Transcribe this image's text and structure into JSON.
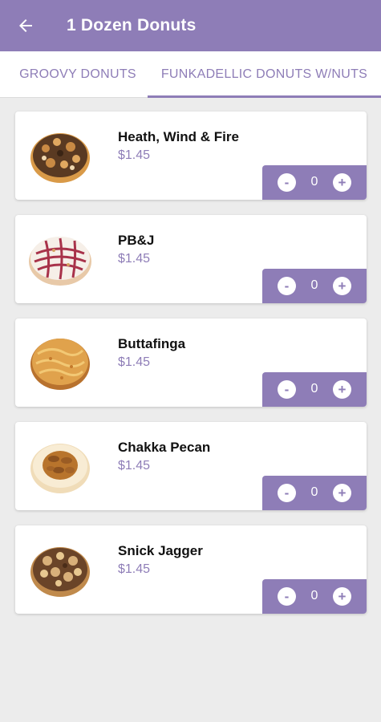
{
  "appbar": {
    "title": "1 Dozen Donuts",
    "back_icon": "arrow-left-icon"
  },
  "tabs": [
    {
      "label": "GROOVY DONUTS",
      "selected": false
    },
    {
      "label": "FUNKADELLIC DONUTS W/NUTS",
      "selected": true
    }
  ],
  "items": [
    {
      "name": "Heath, Wind & Fire",
      "price": "$1.45",
      "qty": "0",
      "minus": "-",
      "plus": "+"
    },
    {
      "name": "PB&J",
      "price": "$1.45",
      "qty": "0",
      "minus": "-",
      "plus": "+"
    },
    {
      "name": "Buttafinga",
      "price": "$1.45",
      "qty": "0",
      "minus": "-",
      "plus": "+"
    },
    {
      "name": "Chakka Pecan",
      "price": "$1.45",
      "qty": "0",
      "minus": "-",
      "plus": "+"
    },
    {
      "name": "Snick Jagger",
      "price": "$1.45",
      "qty": "0",
      "minus": "-",
      "plus": "+"
    }
  ],
  "colors": {
    "primary": "#8e7db7",
    "background": "#ececec",
    "card": "#ffffff"
  }
}
